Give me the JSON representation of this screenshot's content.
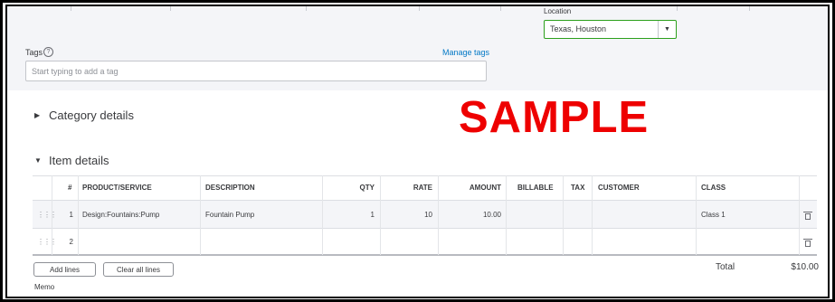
{
  "location": {
    "label": "Location",
    "value": "Texas, Houston"
  },
  "tags": {
    "label": "Tags",
    "manage_label": "Manage tags",
    "placeholder": "Start typing to add a tag"
  },
  "sections": {
    "category_title": "Category details",
    "item_title": "Item details"
  },
  "watermark": "SAMPLE",
  "item_table": {
    "headers": {
      "num": "#",
      "product": "PRODUCT/SERVICE",
      "description": "DESCRIPTION",
      "qty": "QTY",
      "rate": "RATE",
      "amount": "AMOUNT",
      "billable": "BILLABLE",
      "tax": "TAX",
      "customer": "CUSTOMER",
      "class": "CLASS"
    },
    "rows": [
      {
        "num": "1",
        "product": "Design:Fountains:Pump",
        "description": "Fountain Pump",
        "qty": "1",
        "rate": "10",
        "amount": "10.00",
        "class": "Class 1"
      },
      {
        "num": "2",
        "product": "",
        "description": "",
        "qty": "",
        "rate": "",
        "amount": "",
        "class": ""
      }
    ]
  },
  "actions": {
    "add_lines": "Add lines",
    "clear_all_lines": "Clear all lines"
  },
  "totals": {
    "label": "Total",
    "value": "$10.00"
  },
  "memo": {
    "label": "Memo"
  },
  "icons": {
    "help": "help-icon",
    "dropdown": "chevron-down-icon",
    "drag": "drag-handle-icon",
    "delete": "trash-icon",
    "expand": "triangle-right-icon",
    "collapse": "triangle-down-icon"
  },
  "colors": {
    "accent_green": "#2ca01c",
    "link_blue": "#0077c5",
    "watermark_red": "#ee0000"
  }
}
